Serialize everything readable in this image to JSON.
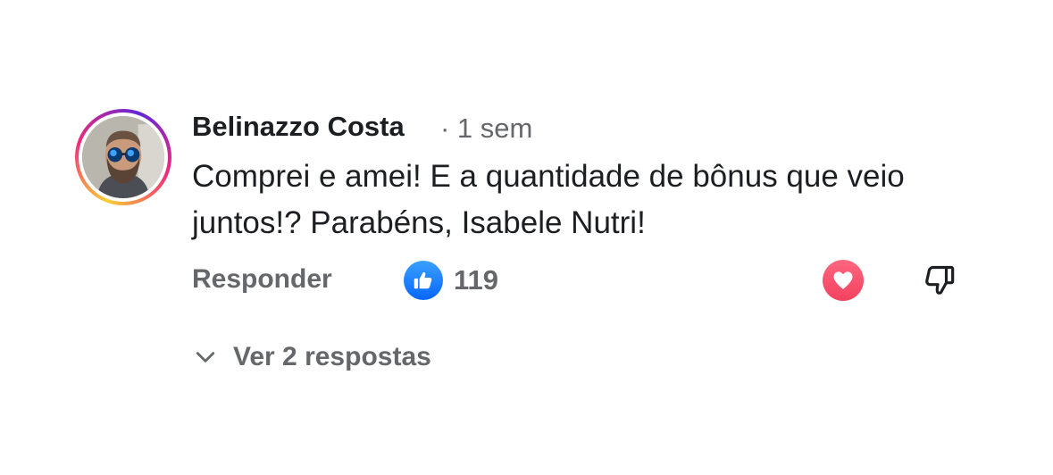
{
  "comment": {
    "author": "Belinazzo Costa",
    "timestamp": "· 1 sem",
    "text": "Comprei e amei! E a quantidade de bônus que veio juntos!? Parabéns, Isabele Nutri!",
    "avatar": "profile-photo"
  },
  "actions": {
    "reply_label": "Responder",
    "like_icon": "thumbs-up-icon",
    "like_count": "119",
    "love_icon": "heart-icon",
    "dislike_icon": "thumbs-down-icon"
  },
  "replies": {
    "label": "Ver 2 respostas",
    "icon": "chevron-down-icon"
  },
  "colors": {
    "like_blue": "#0866ff",
    "love_red": "#f3425f",
    "secondary_text": "#65676b",
    "primary_text": "#1c1e21"
  }
}
